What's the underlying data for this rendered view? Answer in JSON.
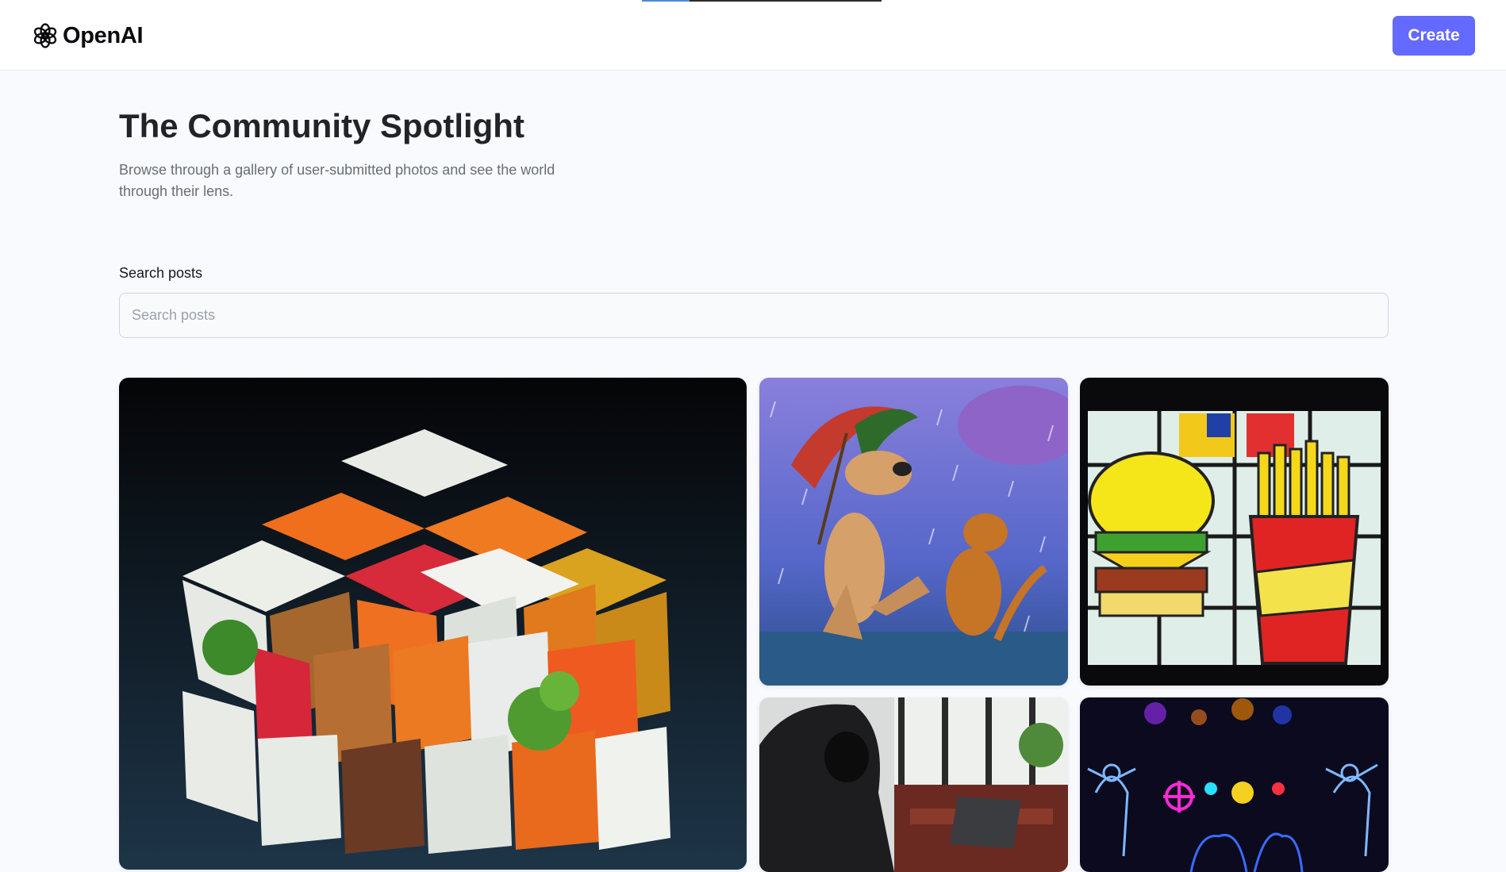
{
  "header": {
    "logo_text": "OpenAI",
    "logo_icon": "openai-logo-icon",
    "create_label": "Create",
    "accent_color": "#6469ff",
    "loading_progress": 0.2
  },
  "page": {
    "title": "The Community Spotlight",
    "subtitle": "Browse through a gallery of user-submitted photos and see the world through their lens."
  },
  "search": {
    "label": "Search posts",
    "placeholder": "Search posts",
    "value": ""
  },
  "gallery": {
    "cards": [
      {
        "name": "card-rubiks-cube-food"
      },
      {
        "name": "card-dog-cat-rain"
      },
      {
        "name": "card-stained-glass-burger"
      },
      {
        "name": "card-hooded-hacker"
      },
      {
        "name": "card-neon-dancers"
      }
    ]
  }
}
